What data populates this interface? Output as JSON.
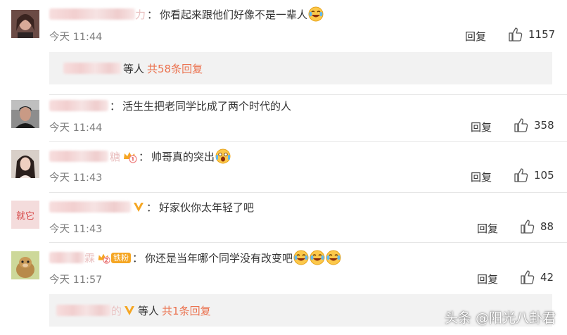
{
  "comments": [
    {
      "text": "你看起来跟他们好像不是一辈人",
      "separator": "：",
      "username_visible_suffix": "力",
      "time": "今天 11:44",
      "reply_label": "回复",
      "likes": "1157",
      "emoji": [
        "laugh-cry-emoji"
      ],
      "replies": {
        "others_label": "等人",
        "count_label": "共58条回复"
      }
    },
    {
      "text": "活生生把老同学比成了两个时代的人",
      "separator": "：",
      "time": "今天 11:44",
      "reply_label": "回复",
      "likes": "358"
    },
    {
      "text": "帅哥真的突出",
      "separator": "：",
      "username_visible_suffix": "糖",
      "time": "今天 11:43",
      "reply_label": "回复",
      "likes": "105",
      "emoji": [
        "shocked-emoji"
      ]
    },
    {
      "text": "好家伙你太年轻了吧",
      "separator": "：",
      "time": "今天 11:43",
      "reply_label": "回复",
      "likes": "88"
    },
    {
      "text": "你还是当年哪个同学没有改变吧",
      "separator": "：",
      "username_visible_suffix": "霖",
      "badge_label": "铁粉",
      "time": "今天 11:57",
      "reply_label": "回复",
      "likes": "42",
      "emoji": [
        "laugh-cry-emoji",
        "laugh-cry-emoji",
        "laugh-cry-emoji"
      ],
      "replies": {
        "name_suffix": "的",
        "others_label": "等人",
        "count_label": "共1条回复"
      }
    }
  ],
  "watermark": "头条 @阳光八卦君",
  "colors": {
    "link": "#eb7350",
    "time": "#808080",
    "reply_bg": "#f2f2f2",
    "vip_orange": "#f5a623"
  }
}
